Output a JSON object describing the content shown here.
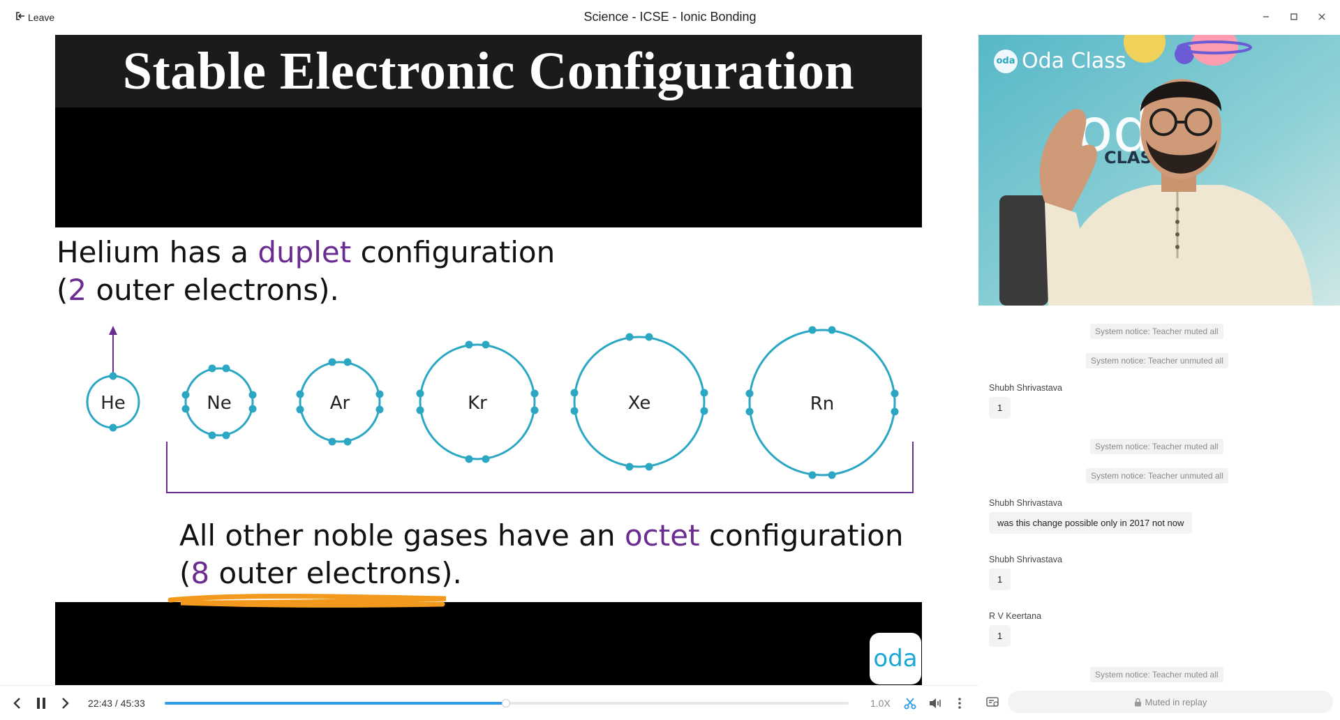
{
  "window": {
    "title": "Science - ICSE - Ionic Bonding",
    "leave_label": "Leave"
  },
  "slide": {
    "title": "Stable Electronic Configuration",
    "helium_line1_a": "Helium has a ",
    "helium_line1_b": "duplet",
    "helium_line1_c": " configuration",
    "helium_line2_a": "(",
    "helium_line2_b": "2",
    "helium_line2_c": " outer electrons).",
    "octet_line1_a": "All other noble gases have an ",
    "octet_line1_b": "octet",
    "octet_line1_c": " configuration",
    "octet_line2_a": "(",
    "octet_line2_b": "8",
    "octet_line2_c": " outer electrons).",
    "atoms": [
      "He",
      "Ne",
      "Ar",
      "Kr",
      "Xe",
      "Rn"
    ],
    "brand": "oda"
  },
  "teacher_cam": {
    "brand_badge": "oda",
    "brand_text": "Oda Class",
    "backdrop_text_a": "od",
    "backdrop_text_b": "CLASS"
  },
  "chat": {
    "notices": [
      "System notice: Teacher muted all",
      "System notice: Teacher unmuted all",
      "System notice: Teacher muted all",
      "System notice: Teacher unmuted all",
      "System notice: Teacher muted all"
    ],
    "messages": [
      {
        "author": "Shubh Shrivastava",
        "text": "1"
      },
      {
        "author": "Shubh Shrivastava",
        "text": "was this change possible only in 2017 not now"
      },
      {
        "author": "Shubh Shrivastava",
        "text": "1"
      },
      {
        "author": "R V Keertana",
        "text": "1"
      }
    ],
    "input_placeholder": "Muted in replay"
  },
  "player": {
    "current_time": "22:43",
    "separator": " / ",
    "duration": "45:33",
    "progress_fraction": 0.499,
    "speed": "1.0X",
    "accent_color": "#2e9ee8"
  }
}
